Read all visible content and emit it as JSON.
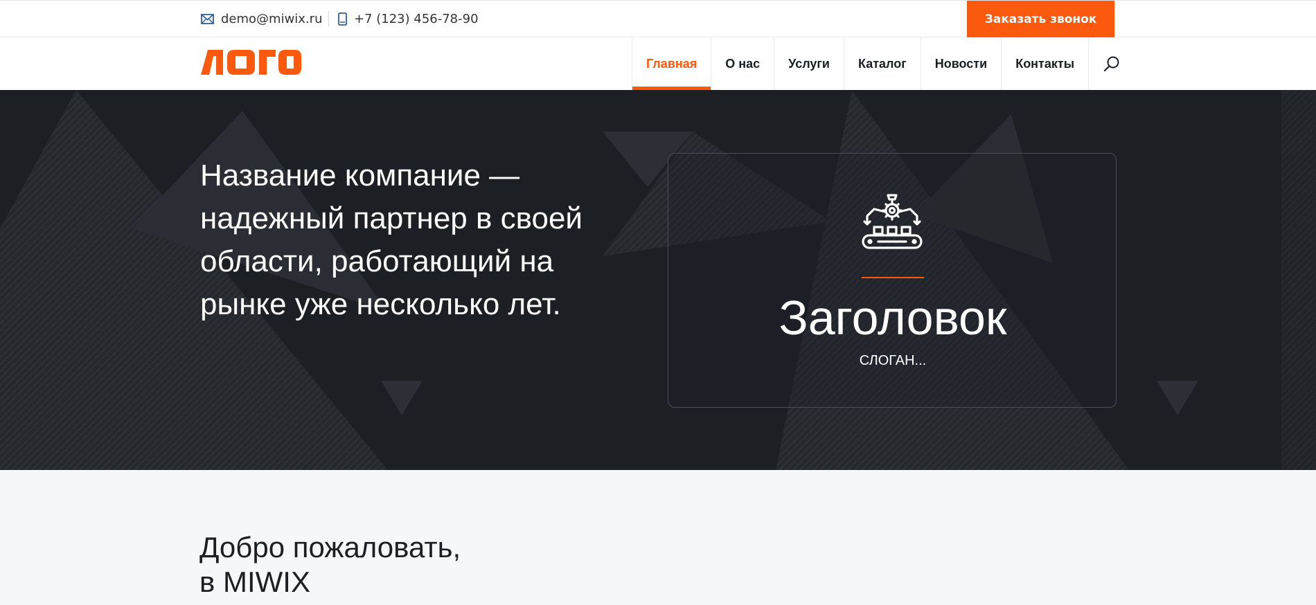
{
  "topbar": {
    "email": "demo@miwix.ru",
    "phone": "+7 (123) 456-78-90",
    "call_button": "Заказать звонок"
  },
  "header": {
    "logo_text": "ЛОГО",
    "nav": [
      {
        "label": "Главная",
        "active": true
      },
      {
        "label": "О нас"
      },
      {
        "label": "Услуги"
      },
      {
        "label": "Каталог"
      },
      {
        "label": "Новости"
      },
      {
        "label": "Контакты"
      }
    ]
  },
  "hero": {
    "text": "Название компание — надежный партнер в своей области, работающий на рынке уже несколько лет.",
    "card": {
      "title": "Заголовок",
      "slogan": "СЛОГАН..."
    }
  },
  "welcome": {
    "line1": "Добро пожаловать,",
    "line2": "в MIWIX"
  },
  "colors": {
    "accent": "#fb5a0e",
    "hero_bg": "#1c2025",
    "page_bg": "#f6f7f9"
  },
  "icons": {
    "email": "envelope-icon",
    "phone": "mobile-phone-icon",
    "search": "search-icon",
    "card": "robot-conveyor-icon"
  }
}
